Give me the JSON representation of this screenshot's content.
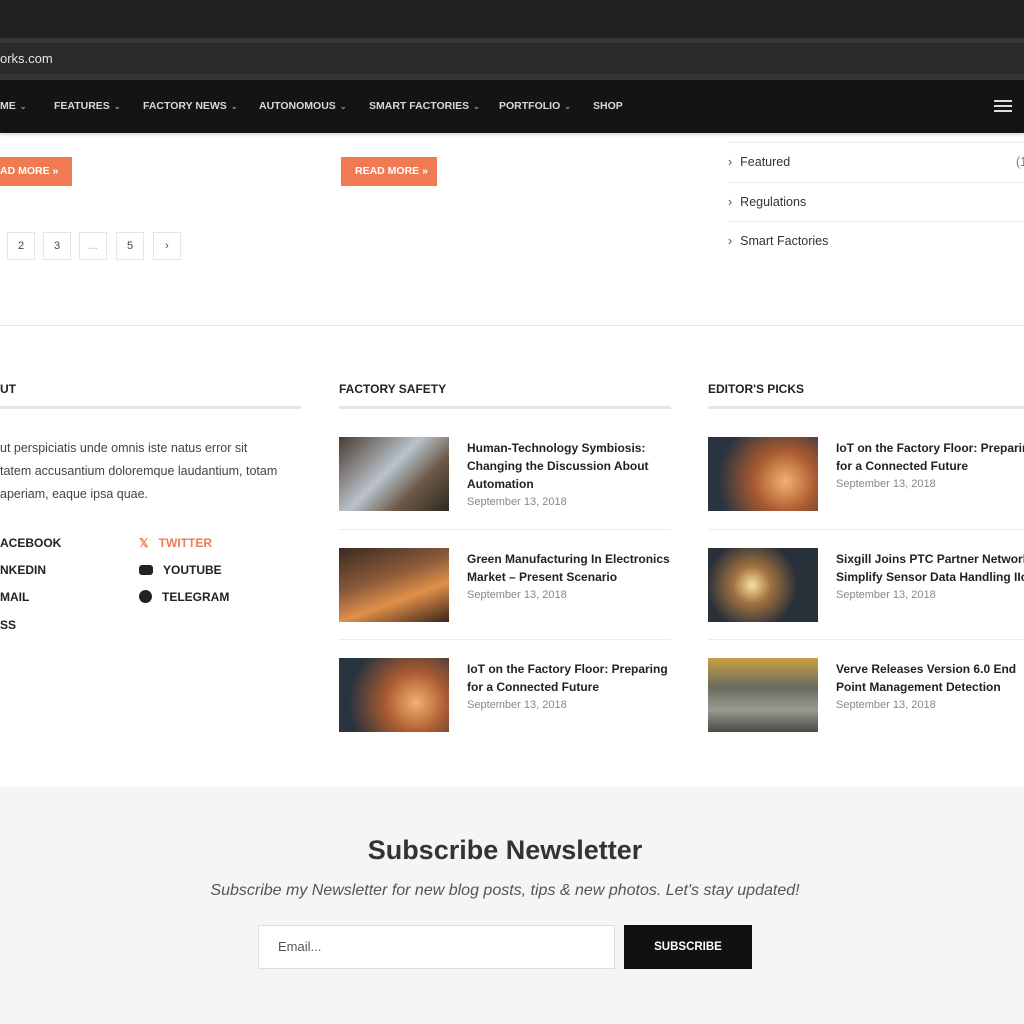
{
  "browser": {
    "url": "orks.com"
  },
  "nav": {
    "items": [
      {
        "label": "ME"
      },
      {
        "label": "FEATURES"
      },
      {
        "label": "FACTORY NEWS"
      },
      {
        "label": "AUTONOMOUS"
      },
      {
        "label": "SMART FACTORIES"
      },
      {
        "label": "PORTFOLIO"
      },
      {
        "label": "SHOP"
      }
    ],
    "chev": "⌄"
  },
  "posts": {
    "read_more": "AD MORE »",
    "read_more2": "READ MORE »"
  },
  "pagination": [
    "2",
    "3",
    "...",
    "5",
    "›"
  ],
  "categories": [
    {
      "label": "Featured",
      "count": "(1"
    },
    {
      "label": "Regulations"
    },
    {
      "label": "Smart Factories"
    }
  ],
  "about": {
    "title": "UT",
    "text": [
      "ut perspiciatis unde omnis iste natus error sit",
      "tatem accusantium doloremque laudantium, totam",
      "aperiam, eaque ipsa quae."
    ],
    "social": [
      {
        "label": "ACEBOOK"
      },
      {
        "label": "NKEDIN"
      },
      {
        "label": "MAIL"
      },
      {
        "label": "SS"
      },
      {
        "label": "TWITTER"
      },
      {
        "label": "YOUTUBE"
      },
      {
        "label": "TELEGRAM"
      }
    ]
  },
  "safety": {
    "title": "FACTORY SAFETY",
    "posts": [
      {
        "title": [
          "Human-Technology Symbiosis:",
          "Changing the Discussion About",
          "Automation"
        ],
        "date": "September 13, 2018"
      },
      {
        "title": [
          "Green Manufacturing In Electronics",
          "Market – Present Scenario"
        ],
        "date": "September 13, 2018"
      },
      {
        "title": [
          "IoT on the Factory Floor: Preparing",
          "for a Connected Future"
        ],
        "date": "September 13, 2018"
      }
    ]
  },
  "picks": {
    "title": "EDITOR'S PICKS",
    "posts": [
      {
        "title": [
          "IoT on the Factory Floor: Preparing",
          "for a Connected Future"
        ],
        "date": "September 13, 2018"
      },
      {
        "title": [
          "Sixgill Joins PTC Partner Network t",
          "Simplify Sensor Data Handling IIoT"
        ],
        "date": "September 13, 2018"
      },
      {
        "title": [
          "Verve Releases Version 6.0 End",
          "Point Management Detection"
        ],
        "date": "September 13, 2018"
      }
    ]
  },
  "newsletter": {
    "title": "Subscribe Newsletter",
    "subtitle": "Subscribe my Newsletter for new blog posts, tips & new photos. Let's stay updated!",
    "placeholder": "Email...",
    "button": "SUBSCRIBE"
  },
  "colors": {
    "accent": "#f07a52",
    "nav_bg": "#141414"
  }
}
